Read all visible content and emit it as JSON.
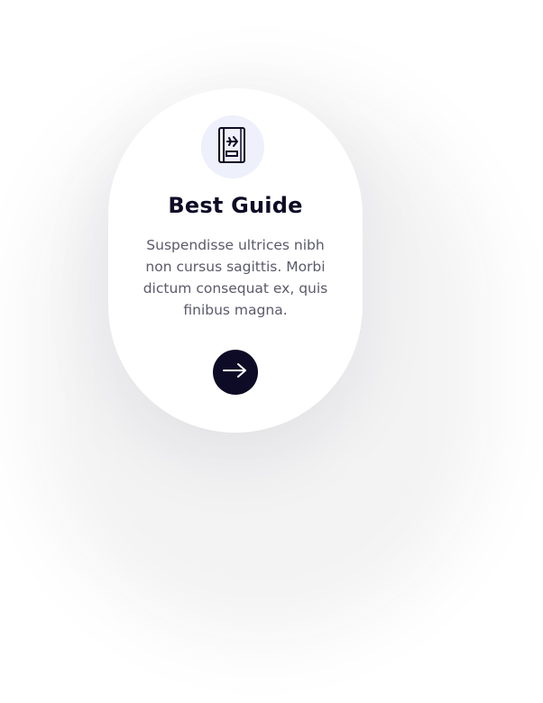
{
  "card": {
    "icon": "book-plane-icon",
    "title": "Best Guide",
    "description": "Suspendisse ultrices nibh non cursus sagittis. Morbi dictum consequat ex, quis finibus magna.",
    "action_icon": "arrow-right-icon"
  },
  "colors": {
    "title": "#0d0b26",
    "text": "#5a5a6a",
    "icon_bg": "#eef0fb",
    "button_bg": "#0d0b26"
  }
}
